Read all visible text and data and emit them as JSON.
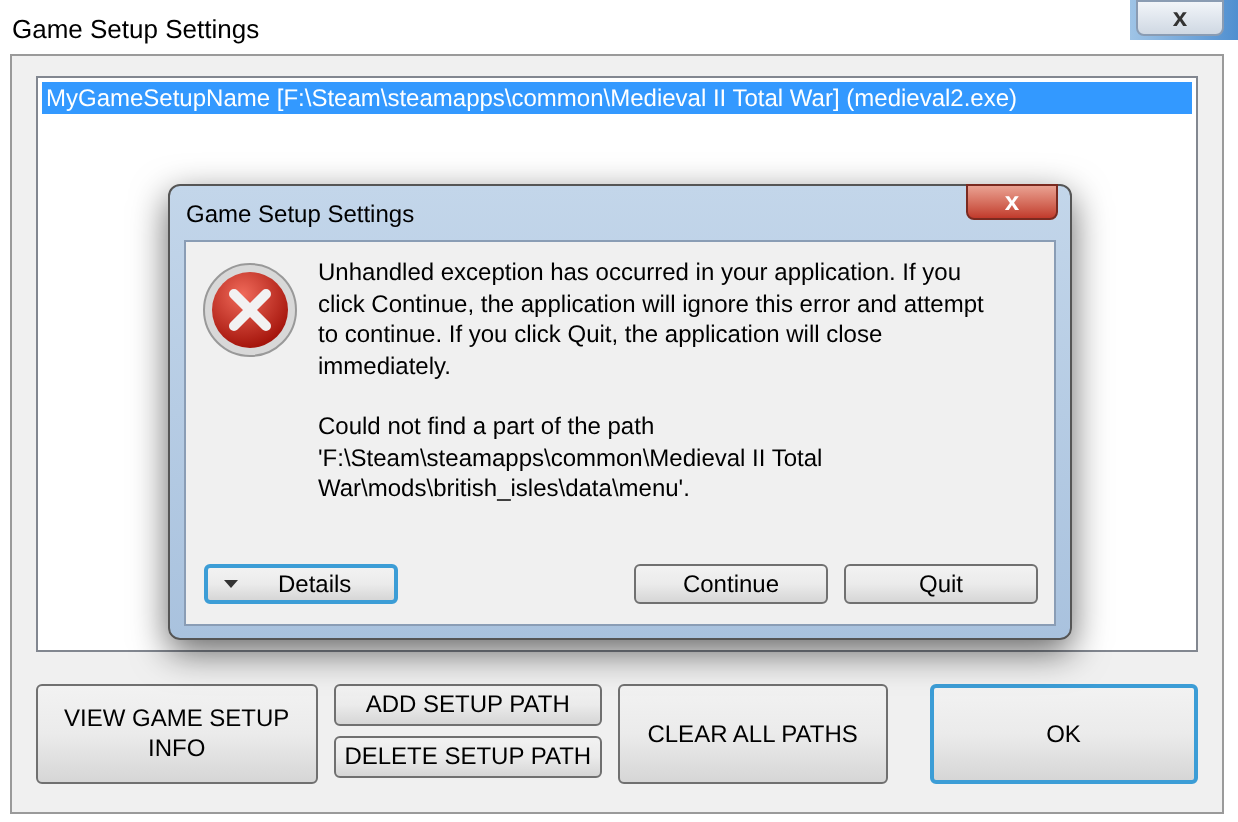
{
  "window": {
    "title": "Game Setup Settings",
    "close": "x"
  },
  "setup_list": [
    {
      "text": "MyGameSetupName [F:\\Steam\\steamapps\\common\\Medieval II Total War] (medieval2.exe)",
      "selected": true
    }
  ],
  "buttons": [
    {
      "label": "VIEW GAME SETUP INFO",
      "focused": false
    },
    {
      "label": "ADD SETUP PATH",
      "focused": false
    },
    {
      "label": "DELETE SETUP PATH",
      "focused": false
    },
    {
      "label": "CLEAR ALL PATHS",
      "focused": false
    },
    {
      "label": "OK",
      "focused": true
    }
  ],
  "error_dialog": {
    "title": "Game Setup Settings",
    "close": "x",
    "message": [
      "Unhandled exception has occurred in your application. If you click Continue, the application will ignore this error and attempt to continue. If you click Quit, the application will close immediately.",
      "Could not find a part of the path 'F:\\Steam\\steamapps\\common\\Medieval II Total War\\mods\\british_isles\\data\\menu'."
    ],
    "buttons": [
      {
        "kind": "details",
        "label": "Details",
        "focused": true
      },
      {
        "kind": "action",
        "label": "Continue",
        "focused": false
      },
      {
        "kind": "action",
        "label": "Quit",
        "focused": false
      }
    ]
  }
}
